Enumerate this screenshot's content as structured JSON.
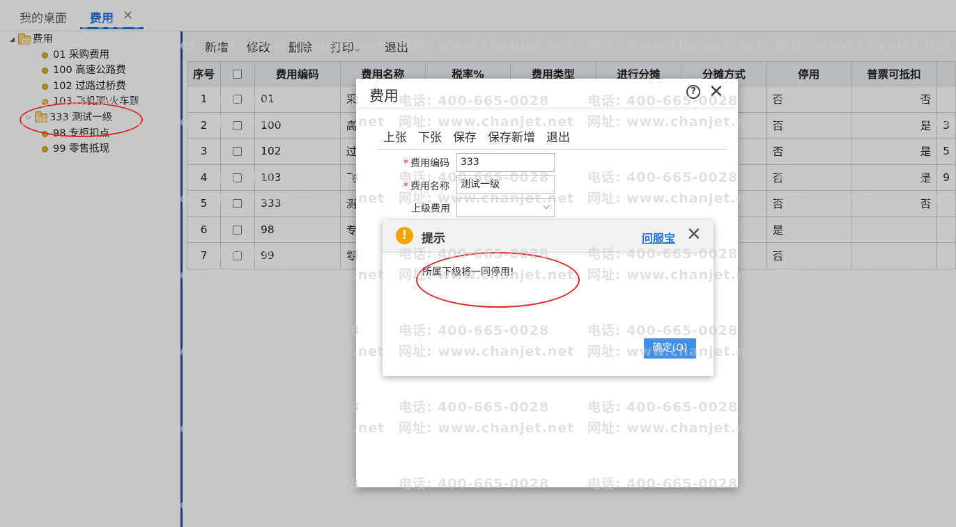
{
  "tabs": {
    "desktop": "我的桌面",
    "active": "费用",
    "close": "✕"
  },
  "tree": {
    "root": "费用",
    "items": [
      {
        "label": "01 采购费用"
      },
      {
        "label": "100 高速公路费"
      },
      {
        "label": "102 过路过桥费"
      },
      {
        "label": "103 飞机票\\火车票"
      },
      {
        "label": "333 测试一级"
      },
      {
        "label": "98 专柜扣点"
      },
      {
        "label": "99 零售抵现"
      }
    ]
  },
  "toolbar": {
    "add": "新增",
    "edit": "修改",
    "delete": "删除",
    "print": "打印",
    "exit": "退出"
  },
  "grid": {
    "headers": [
      "序号",
      "",
      "费用编码",
      "费用名称",
      "税率%",
      "费用类型",
      "进行分摊",
      "分摊方式",
      "停用",
      "普票可抵扣"
    ],
    "rows": [
      {
        "no": "1",
        "code": "01",
        "name": "采",
        "disabled": "否",
        "deduct": "否",
        "extra": ""
      },
      {
        "no": "2",
        "code": "100",
        "name": "高",
        "disabled": "否",
        "deduct": "是",
        "extra": "3"
      },
      {
        "no": "3",
        "code": "102",
        "name": "过",
        "disabled": "否",
        "deduct": "是",
        "extra": "5"
      },
      {
        "no": "4",
        "code": "103",
        "name": "飞",
        "disabled": "否",
        "deduct": "是",
        "extra": "9"
      },
      {
        "no": "5",
        "code": "333",
        "name": "测",
        "disabled": "否",
        "deduct": "否",
        "extra": ""
      },
      {
        "no": "6",
        "code": "98",
        "name": "专",
        "disabled": "是",
        "deduct": "",
        "extra": ""
      },
      {
        "no": "7",
        "code": "99",
        "name": "零",
        "disabled": "否",
        "deduct": "",
        "extra": ""
      }
    ]
  },
  "dialog": {
    "title": "费用",
    "help": "?",
    "close": "✕",
    "toolbar": {
      "prev": "上张",
      "next": "下张",
      "save": "保存",
      "save_new": "保存新增",
      "exit": "退出"
    },
    "form": {
      "code_label": "费用编码",
      "code_value": "333",
      "name_label": "费用名称",
      "name_value": "测试一级",
      "parent_label": "上级费用",
      "parent_value": "",
      "required_mark": "*"
    }
  },
  "alert": {
    "icon": "!",
    "title": "提示",
    "link": "问服宝",
    "close": "✕",
    "message": "所属下级将一同停用!",
    "ok": "确定(O)"
  },
  "watermark": {
    "phone": "电话: 400-665-0028",
    "site": "网址: www.chanjet.net"
  },
  "colors": {
    "accent": "#1e6fd9",
    "annotation": "#e0241f",
    "warning": "#f5a300",
    "ok_button": "#3d8fe8"
  }
}
